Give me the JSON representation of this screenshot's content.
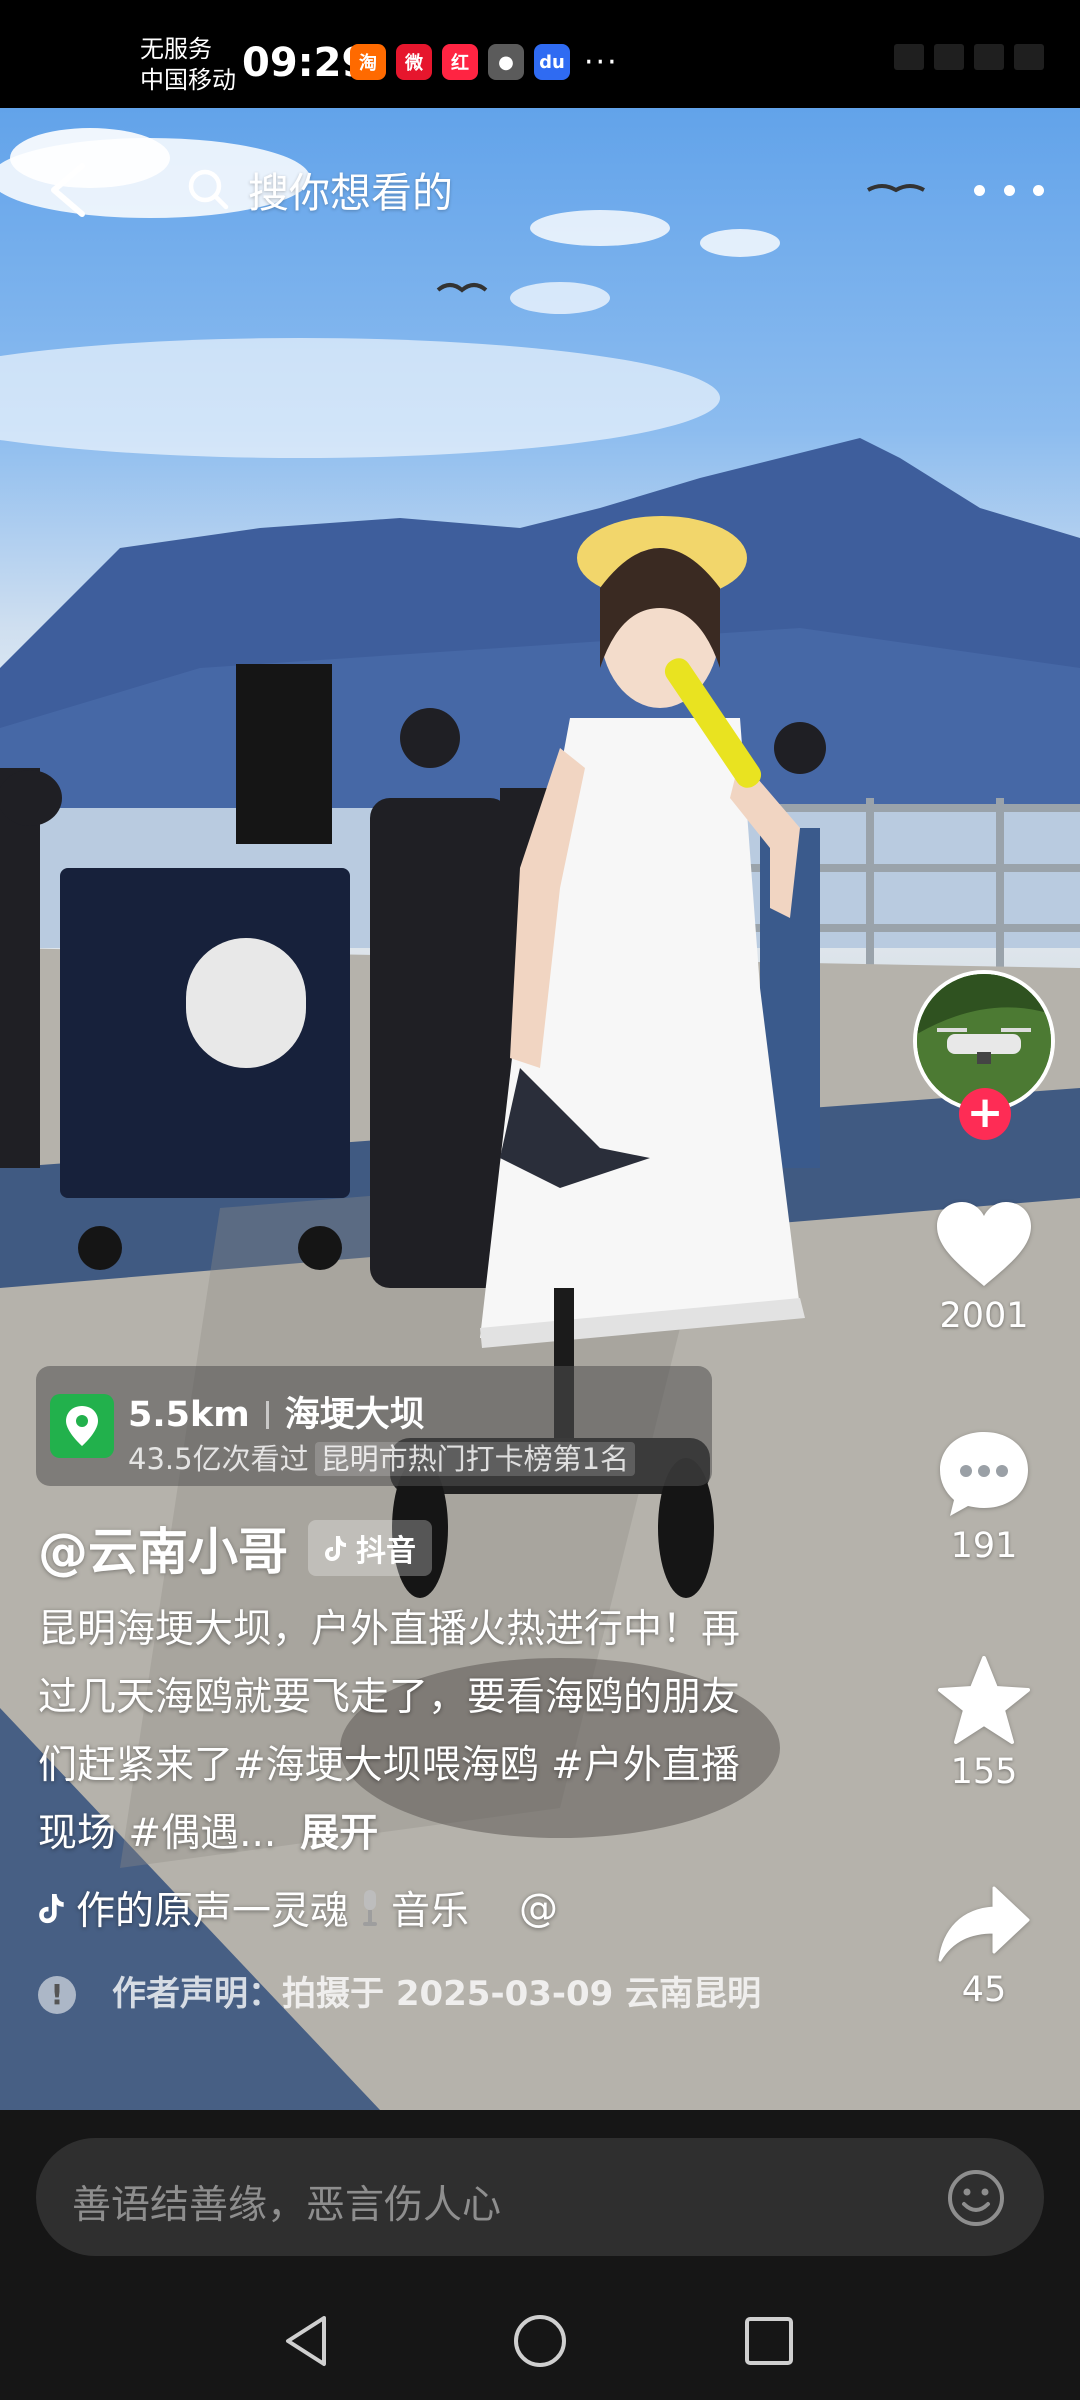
{
  "status_bar": {
    "carrier_line1": "无服务",
    "carrier_line2": "中国移动",
    "time": "09:29",
    "app_icons": [
      {
        "name": "taobao-icon",
        "glyph": "淘",
        "color": "#ff6a00"
      },
      {
        "name": "weibo-icon",
        "glyph": "微",
        "color": "#e6162d"
      },
      {
        "name": "redbook-icon",
        "glyph": "红",
        "color": "#ff2442"
      },
      {
        "name": "avatar-app-icon",
        "glyph": "●",
        "color": "#5b5b5b"
      },
      {
        "name": "baidu-icon",
        "glyph": "du",
        "color": "#2f6bf2"
      }
    ],
    "more": "···"
  },
  "top_bar": {
    "search_placeholder": "搜你想看的"
  },
  "actions": {
    "likes": "2001",
    "comments": "191",
    "favorites": "155",
    "shares": "45"
  },
  "location": {
    "distance": "5.5km",
    "place": "海埂大坝",
    "views": "43.5亿次看过",
    "rank": "昆明市热门打卡榜第1名"
  },
  "author": {
    "name": "@云南小哥",
    "badge": "抖音"
  },
  "caption": {
    "text": "昆明海埂大坝，户外直播火热进行中！再过几天海鸥就要飞走了，要看海鸥的朋友们赶紧来了#海埂大坝喂海鸥 #户外直播现场 #偶遇...",
    "expand": "展开"
  },
  "music": {
    "text_before": "作的原声一灵魂",
    "text_after": "音乐",
    "mention": "@"
  },
  "disclaimer": {
    "text": "作者声明：拍摄于 2025-03-09 云南昆明"
  },
  "progress": {
    "fraction": 0.22
  },
  "comment_bar": {
    "placeholder": "善语结善缘，恶言伤人心"
  },
  "colors": {
    "accent": "#fe2c55",
    "location_pin": "#22b14c",
    "sky": "#6aa6ea",
    "mountain": "#3f5f9e"
  }
}
